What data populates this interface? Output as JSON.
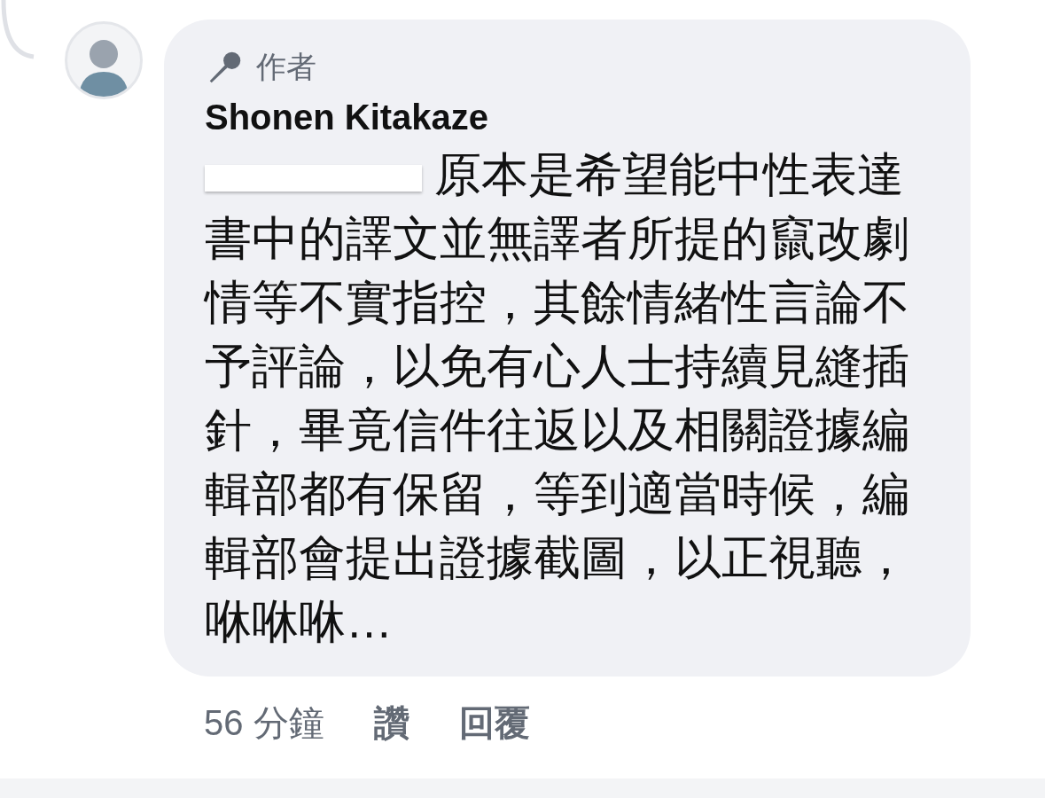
{
  "comment": {
    "badge": "作者",
    "author": "Shonen Kitakaze",
    "mention_redacted": true,
    "body": "原本是希望能中性表達書中的譯文並無譯者所提的竄改劇情等不實指控，其餘情緒性言論不予評論，以免有心人士持續見縫插針，畢竟信件往返以及相關證據編輯部都有保留，等到適當時候，編輯部會提出證據截圖，以正視聽，咻咻咻…",
    "time": "56 分鐘",
    "actions": [
      "讚",
      "回覆"
    ]
  }
}
